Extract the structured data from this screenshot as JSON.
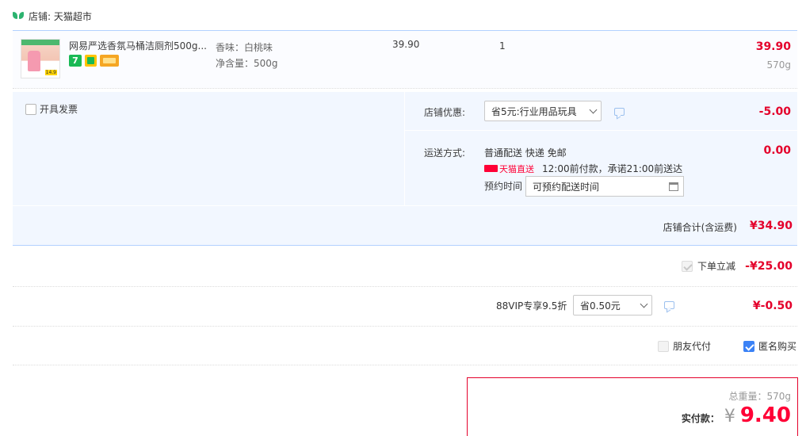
{
  "shop": {
    "label": "店铺: 天猫超市"
  },
  "item": {
    "title": "网易严选香氛马桶洁厕剂500g...",
    "spec1": "香味：白桃味",
    "spec2": "净含量：500g",
    "unit_price": "39.90",
    "quantity": "1",
    "subtotal": "39.90",
    "weight": "570g",
    "thumb_tag": "14.9"
  },
  "invoice": {
    "label": "开具发票"
  },
  "shop_discount": {
    "label": "店铺优惠:",
    "selected": "省5元:行业用品玩具",
    "amount": "-5.00"
  },
  "shipping": {
    "label": "运送方式:",
    "method": "普通配送 快递 免邮",
    "amount": "0.00",
    "direct_label": "天猫直送",
    "promise": "12:00前付款，承诺21:00前送达",
    "reserve_label": "预约时间",
    "reserve_placeholder": "可预约配送时间"
  },
  "shop_total": {
    "label": "店铺合计(含运费)",
    "amount": "¥34.90"
  },
  "instant_discount": {
    "label": "下单立减",
    "amount": "-¥25.00"
  },
  "vip": {
    "label": "88VIP专享9.5折",
    "selected": "省0.50元",
    "amount": "¥-0.50"
  },
  "options": {
    "friend_pay": "朋友代付",
    "anonymous": "匿名购买"
  },
  "summary": {
    "weight_label": "总重量：",
    "weight_value": "570g",
    "pay_label": "实付款：",
    "currency": "¥",
    "pay_amount": "9.40"
  },
  "colors": {
    "accent_red": "#ff0036",
    "border_blue": "#b2d1ff",
    "panel_blue": "#f2f7ff"
  }
}
